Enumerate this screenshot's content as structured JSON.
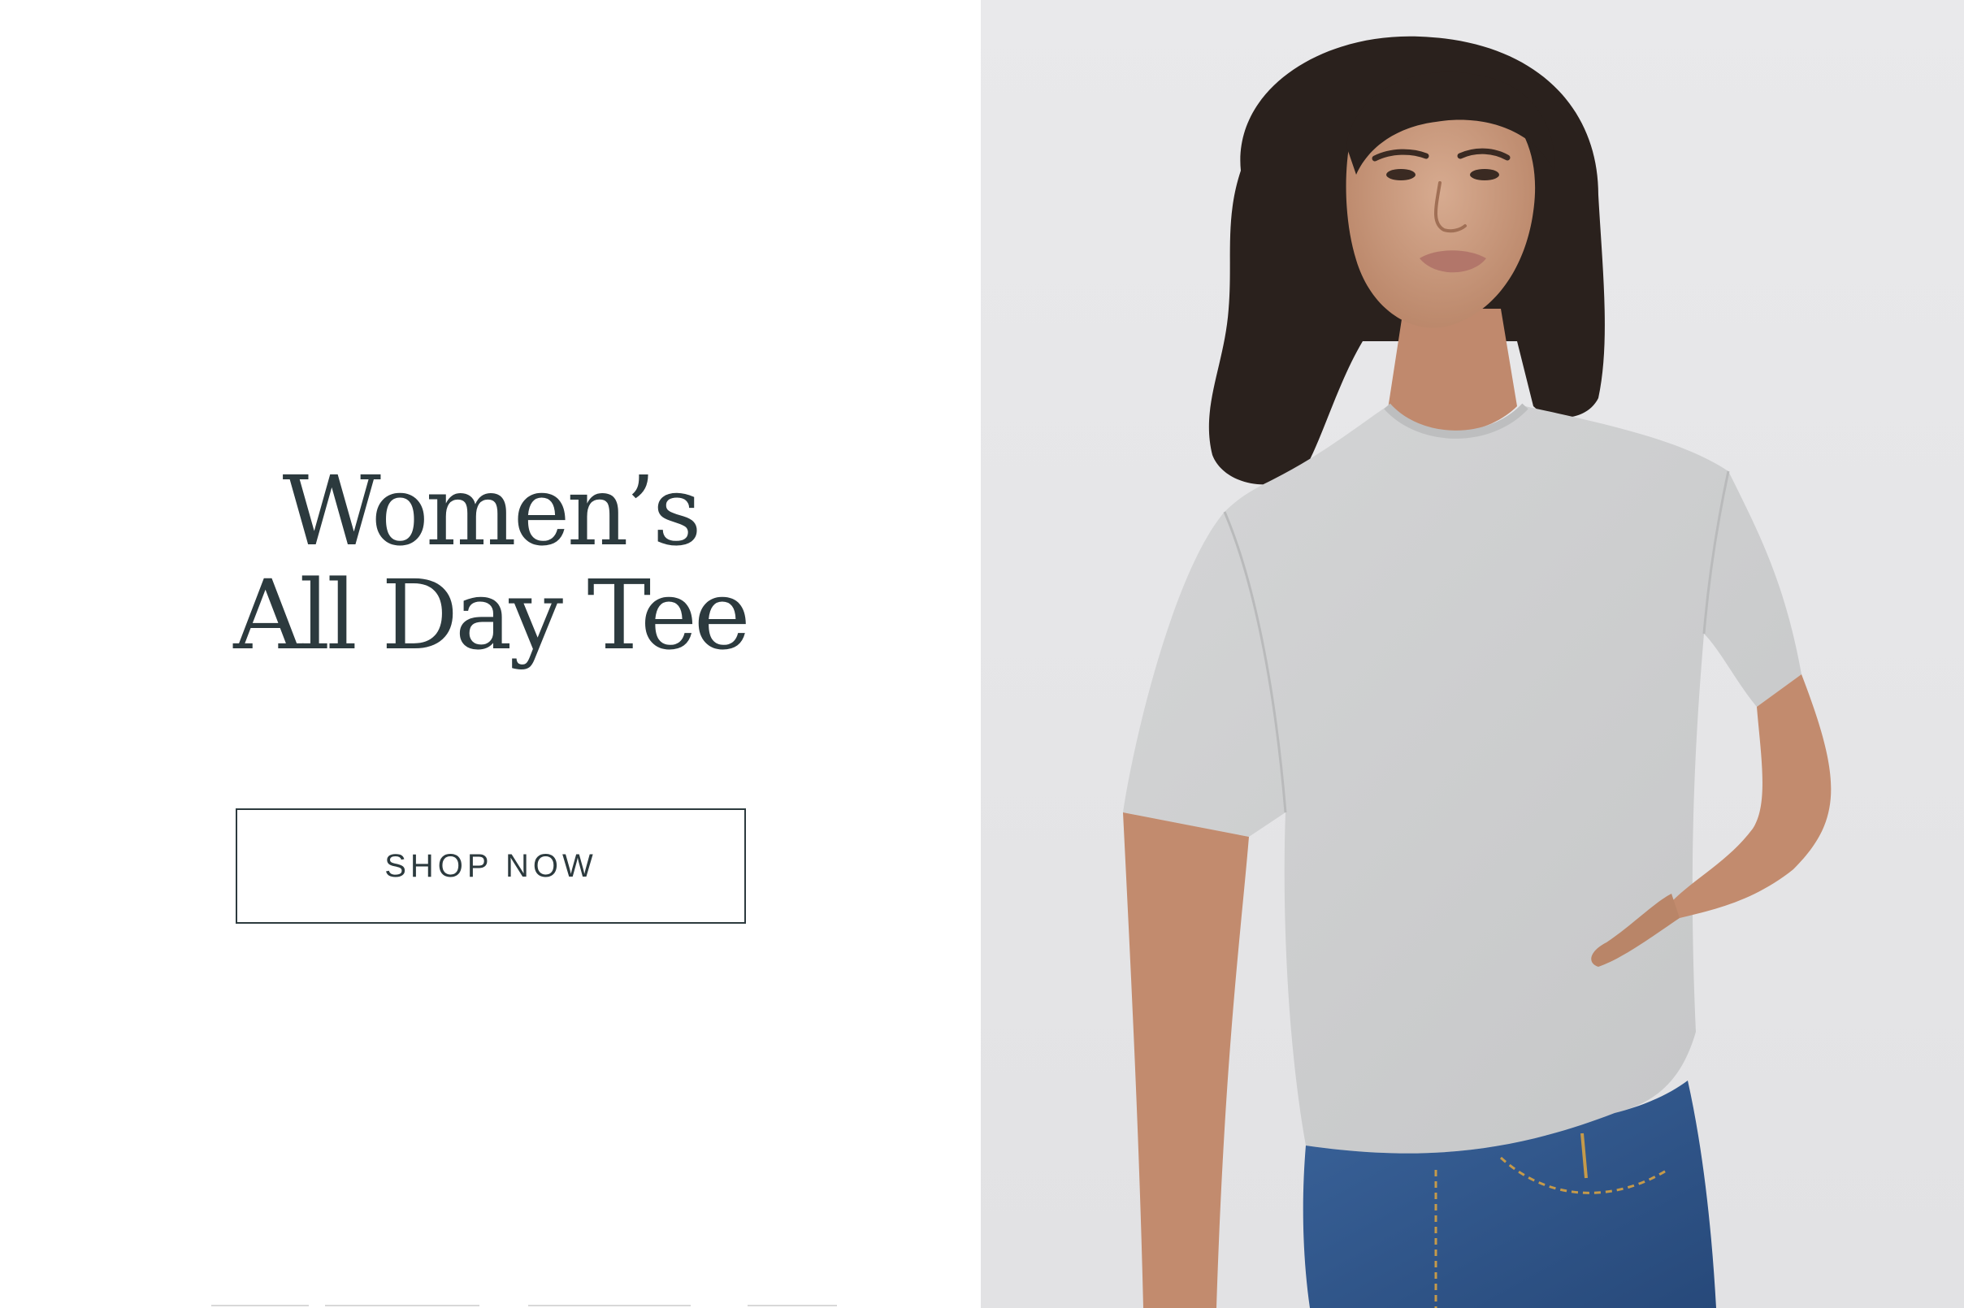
{
  "hero": {
    "headline_line1": "Women’s",
    "headline_line2": "All Day Tee",
    "cta_label": "SHOP NOW"
  },
  "colors": {
    "text": "#2c3a3e",
    "photo_background": "#e6e6e8",
    "tee": "#cfd0d1",
    "denim": "#2f5687",
    "hair": "#2a211d",
    "skin": "#c99a7f"
  },
  "icons": {
    "model_photo": "model-photo-image"
  }
}
